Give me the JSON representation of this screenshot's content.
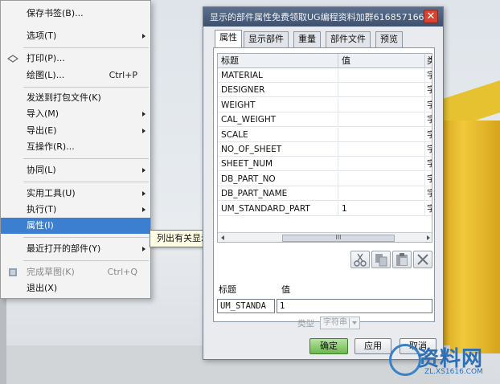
{
  "menu": {
    "items": [
      {
        "label": "保存书签(B)...",
        "shortcut": "",
        "submenu": false,
        "disabled": false
      },
      {
        "label": "选项(T)",
        "shortcut": "",
        "submenu": true,
        "disabled": false
      },
      {
        "label": "打印(P)...",
        "shortcut": "",
        "submenu": false,
        "disabled": false
      },
      {
        "label": "绘图(L)...",
        "shortcut": "Ctrl+P",
        "submenu": false,
        "disabled": false
      },
      {
        "label": "发送到打包文件(K)",
        "shortcut": "",
        "submenu": false,
        "disabled": false
      },
      {
        "label": "导入(M)",
        "shortcut": "",
        "submenu": true,
        "disabled": false
      },
      {
        "label": "导出(E)",
        "shortcut": "",
        "submenu": true,
        "disabled": false
      },
      {
        "label": "互操作(R)...",
        "shortcut": "",
        "submenu": false,
        "disabled": false
      },
      {
        "label": "协同(L)",
        "shortcut": "",
        "submenu": true,
        "disabled": false
      },
      {
        "label": "实用工具(U)",
        "shortcut": "",
        "submenu": true,
        "disabled": false
      },
      {
        "label": "执行(T)",
        "shortcut": "",
        "submenu": true,
        "disabled": false
      },
      {
        "label": "属性(I)",
        "shortcut": "",
        "submenu": false,
        "disabled": false
      },
      {
        "label": "最近打开的部件(Y)",
        "shortcut": "",
        "submenu": true,
        "disabled": false
      },
      {
        "label": "完成草图(K)",
        "shortcut": "Ctrl+Q",
        "submenu": false,
        "disabled": true
      },
      {
        "label": "退出(X)",
        "shortcut": "",
        "submenu": false,
        "disabled": false
      }
    ]
  },
  "tooltip": "列出有关显示的部件的信息。",
  "dialog": {
    "title": "显示的部件属性免费领取UG编程资料加群616857166",
    "close_glyph": "✕",
    "tabs": [
      "属性",
      "显示部件",
      "重量",
      "部件文件",
      "预览"
    ],
    "grid": {
      "headers": [
        "标题",
        "值",
        "类"
      ],
      "rows": [
        {
          "title": "MATERIAL",
          "value": "",
          "type": "字"
        },
        {
          "title": "DESIGNER",
          "value": "",
          "type": "字"
        },
        {
          "title": "WEIGHT",
          "value": "",
          "type": "字"
        },
        {
          "title": "CAL_WEIGHT",
          "value": "",
          "type": "字"
        },
        {
          "title": "SCALE",
          "value": "",
          "type": "字"
        },
        {
          "title": "NO_OF_SHEET",
          "value": "",
          "type": "字"
        },
        {
          "title": "SHEET_NUM",
          "value": "",
          "type": "字"
        },
        {
          "title": "DB_PART_NO",
          "value": "",
          "type": "字"
        },
        {
          "title": "DB_PART_NAME",
          "value": "",
          "type": "字"
        },
        {
          "title": "UM_STANDARD_PART",
          "value": "1",
          "type": "字"
        }
      ],
      "scroll_thumb": "III"
    },
    "tool_icons": [
      "cut-icon",
      "copy-icon",
      "paste-icon",
      "delete-icon"
    ],
    "editor": {
      "title_label": "标题",
      "value_label": "值",
      "title_value": "UM_STANDA",
      "value_value": "1",
      "type_label": "类型",
      "type_value": "字符串"
    },
    "buttons": {
      "ok": "确定",
      "apply": "应用",
      "cancel": "取消"
    }
  },
  "watermark": {
    "text": "资料网",
    "url": "ZL.XS1616.COM"
  }
}
